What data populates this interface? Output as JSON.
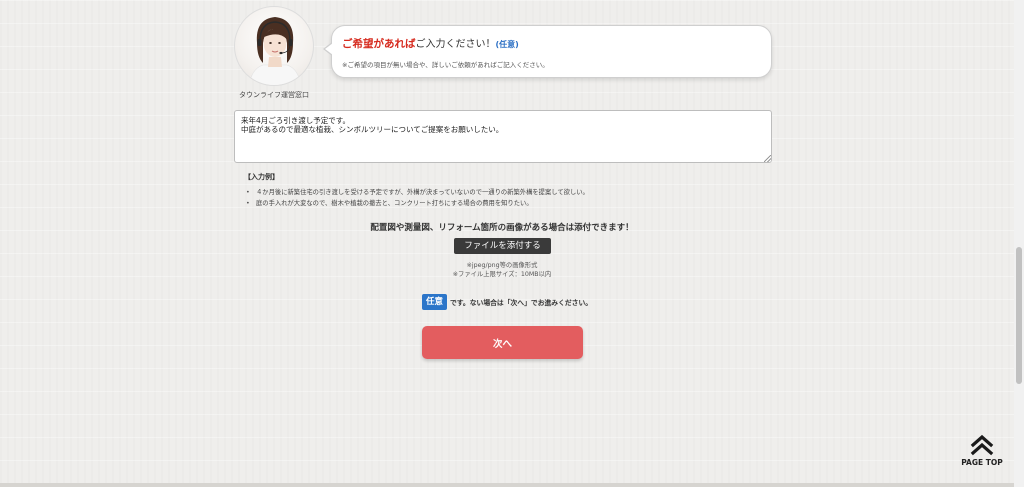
{
  "operator": {
    "caption": "タウンライフ運営窓口"
  },
  "bubble": {
    "title_emphasis": "ご希望があれば",
    "title_rest": "ご入力ください！",
    "optional_tag": "(任意)",
    "subtitle": "※ご希望の項目が無い場合や、詳しいご依頼があればご記入ください。"
  },
  "request_field": {
    "value": "来年4月ごろ引き渡し予定です。\n中庭があるので最適な植栽、シンボルツリーについてご提案をお願いしたい。"
  },
  "example": {
    "heading": "【入力例】",
    "items": [
      "４か月後に新築住宅の引き渡しを受ける予定ですが、外構が決まっていないので一通りの新築外構を提案して欲しい。",
      "庭の手入れが大変なので、樹木や植栽の撤去と、コンクリート打ちにする場合の費用を知りたい。"
    ]
  },
  "upload": {
    "heading": "配置図や測量図、リフォーム箇所の画像がある場合は添付できます！",
    "button_label": "ファイルを添付する",
    "note_format": "※jpeg/png等の画像形式",
    "note_size": "※ファイル上限サイズ：10MB以内"
  },
  "optional_notice": {
    "badge": "任意",
    "text": "です。ない場合は「次へ」でお進みください。"
  },
  "next_button": {
    "label": "次へ"
  },
  "page_top": {
    "label": "PAGE TOP",
    "icon": "double-chevron-up-icon"
  },
  "colors": {
    "accent_red": "#e35d5f",
    "emphasis_red": "#d62a1e",
    "optional_blue": "#2b75c9",
    "dark_button": "#3a3a3a"
  }
}
